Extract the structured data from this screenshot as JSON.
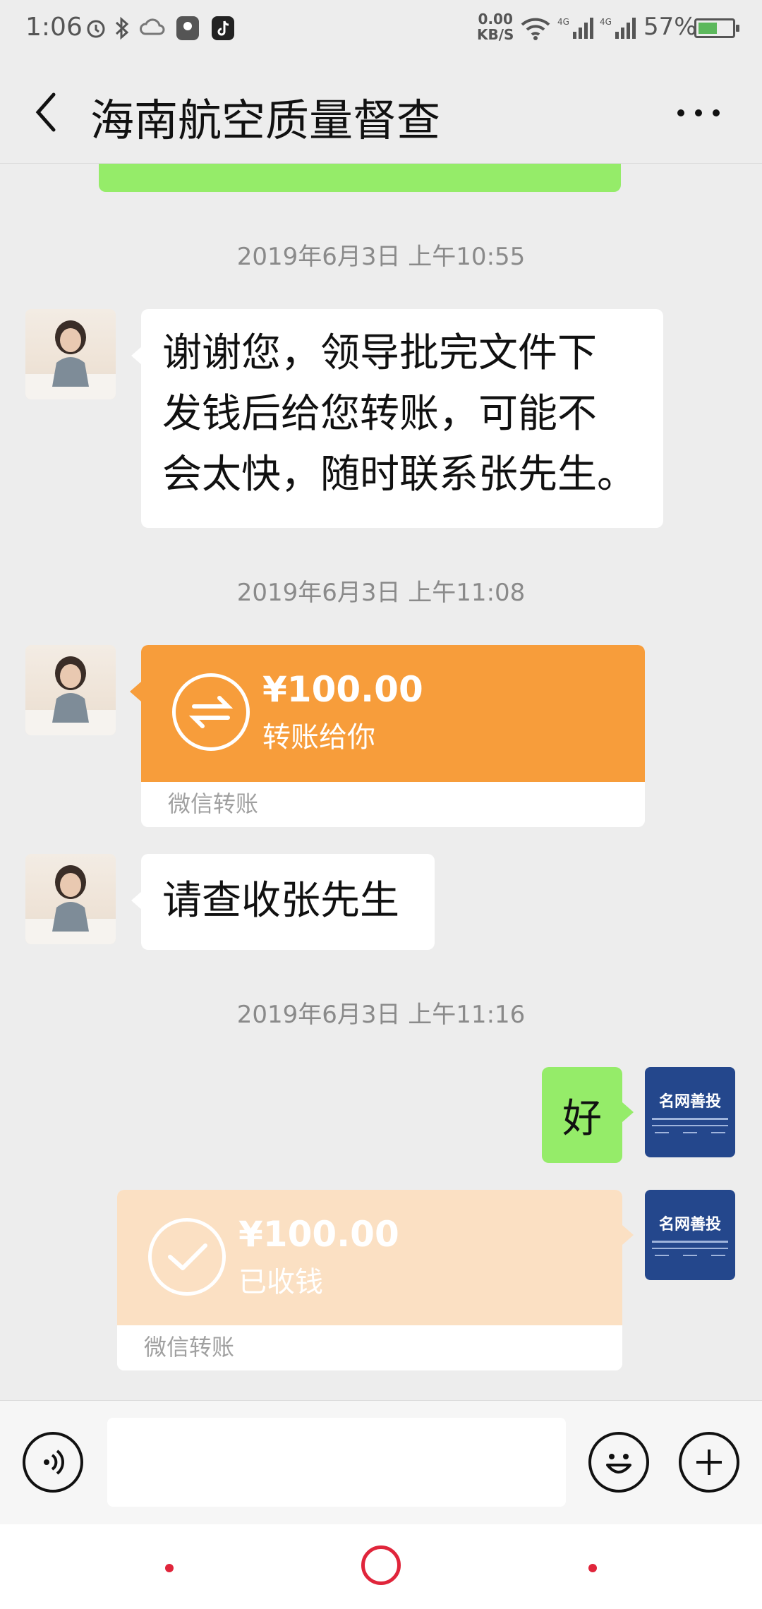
{
  "status_bar": {
    "time": "1:06",
    "net_speed_value": "0.00",
    "net_speed_unit": "KB/S",
    "signal_1_label": "4G",
    "signal_2_label": "4G",
    "battery_percent": "57%",
    "battery_level": 0.57,
    "icons": [
      "alarm-icon",
      "bluetooth-icon",
      "cloud-icon",
      "map-pin-app-icon",
      "tiktok-app-icon",
      "wifi-icon",
      "signal-icon",
      "battery-icon"
    ]
  },
  "header": {
    "title": "海南航空质量督查",
    "back_icon": "chevron-left-icon",
    "more_icon": "more-dots-icon"
  },
  "messages": {
    "ts1": "2019年6月3日 上午10:55",
    "msg1_lines": [
      "谢谢您，领导批完文件下",
      "发钱后给您转账，可能不",
      "会太快，随时联系张先生。"
    ],
    "ts2": "2019年6月3日 上午11:08",
    "transfer1": {
      "amount": "¥100.00",
      "desc": "转账给你",
      "footer": "微信转账",
      "color": "#f79d3b"
    },
    "msg2": "请查收张先生",
    "ts3": "2019年6月3日 上午11:16",
    "reply": "好",
    "transfer2": {
      "amount": "¥100.00",
      "desc": "已收钱",
      "footer": "微信转账",
      "color": "#fbe0c3"
    },
    "brand_avatar_text": "名网善投"
  },
  "input_bar": {
    "voice_icon": "voice-icon",
    "emoji_icon": "emoji-icon",
    "plus_icon": "plus-icon"
  },
  "colors": {
    "accent_green": "#95ec69",
    "transfer_orange": "#f79d3b",
    "transfer_received": "#fbe0c3",
    "nav_red": "#e0253b"
  }
}
